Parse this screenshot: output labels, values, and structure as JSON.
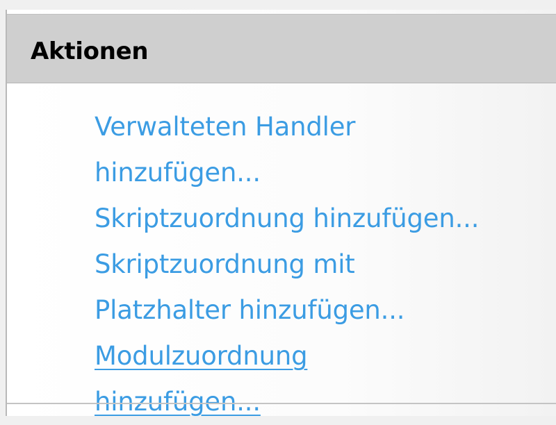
{
  "panel": {
    "title": "Aktionen"
  },
  "actions": [
    {
      "line1": "Verwalteten Handler",
      "line2": "hinzufügen..."
    },
    {
      "line1": "Skriptzuordnung hinzufügen..."
    },
    {
      "line1": "Skriptzuordnung mit",
      "line2": "Platzhalter hinzufügen..."
    },
    {
      "line1": "Modulzuordnung",
      "line2": "hinzufügen...",
      "hovered": true
    }
  ],
  "colors": {
    "link": "#3b9ce3",
    "header_bg": "#cfcfcf",
    "title": "#000000"
  }
}
